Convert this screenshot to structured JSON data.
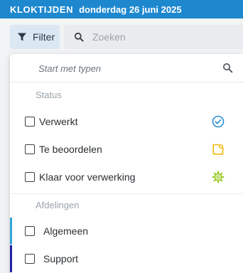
{
  "header": {
    "app_title": "KLOKTIJDEN",
    "date": "donderdag 26 juni 2025",
    "bg_color": "#1e88cf"
  },
  "toolbar": {
    "filter_label": "Filter",
    "filter_icon": "funnel-icon",
    "search": {
      "placeholder": "Zoeken",
      "value": "",
      "icon": "search-icon"
    }
  },
  "dropdown": {
    "search": {
      "placeholder": "Start met typen",
      "value": "",
      "icon": "search-icon"
    },
    "status_section": {
      "title": "Status",
      "items": [
        {
          "label": "Verwerkt",
          "checked": false,
          "icon": "check-circle-icon",
          "color": "#2a8fd6"
        },
        {
          "label": "Te beoordelen",
          "checked": false,
          "icon": "review-note-icon",
          "color": "#f2b807"
        },
        {
          "label": "Klaar voor verwerking",
          "checked": false,
          "icon": "gear-icon",
          "color": "#9ccc2c"
        }
      ]
    },
    "departments_section": {
      "title": "Afdelingen",
      "items": [
        {
          "label": "Algemeen",
          "checked": false,
          "color": "#2fa4d6"
        },
        {
          "label": "Support",
          "checked": false,
          "color": "#2020a0"
        }
      ]
    }
  }
}
